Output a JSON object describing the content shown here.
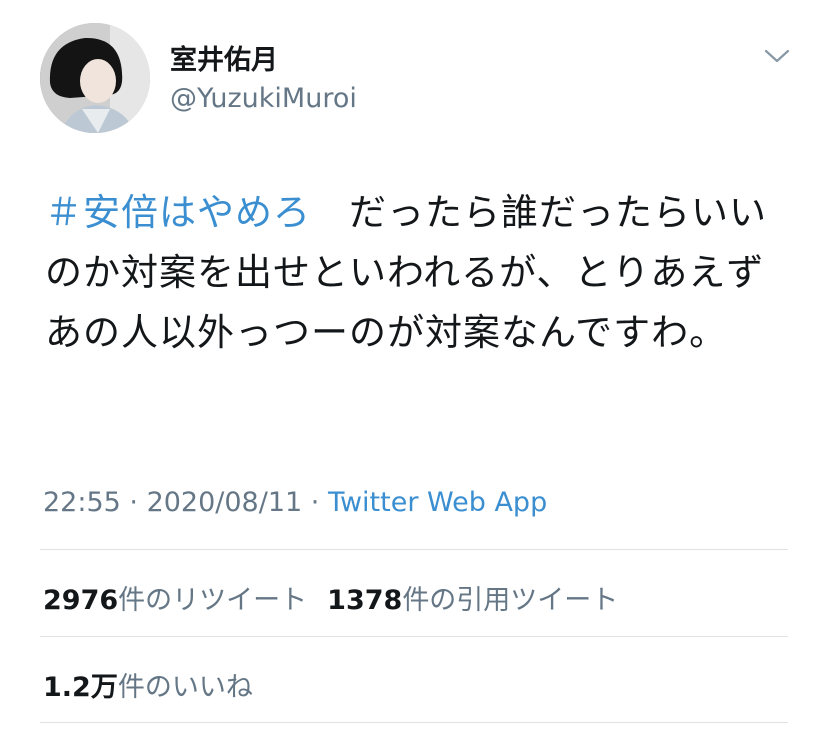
{
  "user": {
    "display_name": "室井佑月",
    "handle": "@YuzukiMuroi"
  },
  "tweet": {
    "hashtag": "＃安倍はやめろ",
    "body": "　だったら誰だったらいいのか対案を出せといわれるが、とりあえずあの人以外っつーのが対案なんですわ。"
  },
  "meta": {
    "time": "22:55",
    "separator": " · ",
    "date": "2020/08/11",
    "source": "Twitter Web App"
  },
  "stats": {
    "retweets_count": "2976",
    "retweets_label": "件のリツイート",
    "quotes_count": "1378",
    "quotes_label": "件の引用ツイート",
    "likes_count": "1.2万",
    "likes_label": "件のいいね"
  },
  "colors": {
    "link": "#3b8fd1",
    "secondary_text": "#657786",
    "primary_text": "#14171a",
    "divider": "#dfe3e6"
  },
  "icons": {
    "menu": "chevron-down-icon"
  }
}
